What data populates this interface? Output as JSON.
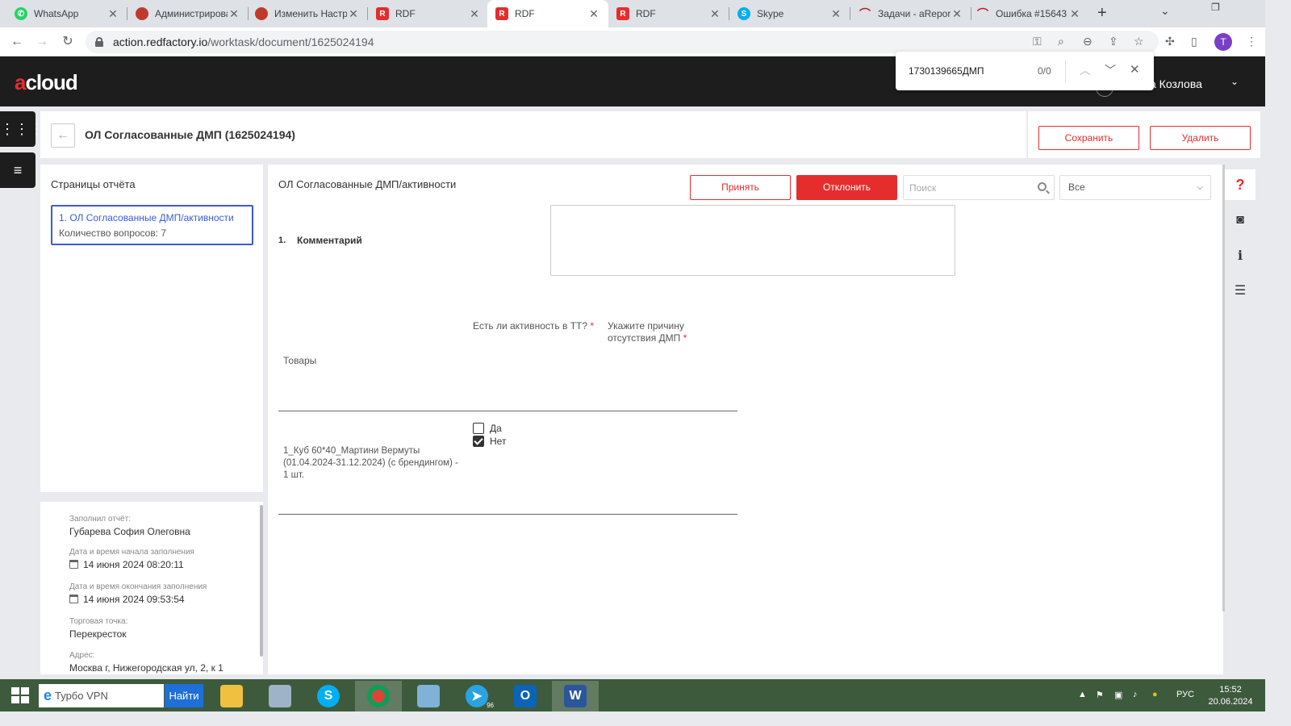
{
  "browser": {
    "tabs": [
      {
        "title": "WhatsApp",
        "icon": "whatsapp-icon",
        "color": "#25d366"
      },
      {
        "title": "Администрирование",
        "icon": "app-icon",
        "color": "#c0392b"
      },
      {
        "title": "Изменить Настройки",
        "icon": "app-icon",
        "color": "#c0392b"
      },
      {
        "title": "RDF",
        "icon": "rdf-icon",
        "color": "#e52d2d"
      },
      {
        "title": "RDF",
        "icon": "rdf-icon",
        "color": "#e52d2d",
        "active": true
      },
      {
        "title": "RDF",
        "icon": "rdf-icon",
        "color": "#e52d2d"
      },
      {
        "title": "Skype",
        "icon": "skype-icon",
        "color": "#00aff0"
      },
      {
        "title": "Задачи - aReport",
        "icon": "redmine-icon",
        "color": "#b32024"
      },
      {
        "title": "Ошибка #15643",
        "icon": "redmine-icon",
        "color": "#b32024"
      }
    ],
    "url_domain": "action.redfactory.io",
    "url_path": "/worktask/document/1625024194",
    "profile_initial": "T"
  },
  "find_bar": {
    "query": "1730139665ДМП",
    "count": "0/0"
  },
  "app": {
    "logo_accent": "a",
    "logo_rest": "cloud",
    "user_name": "а Козлова"
  },
  "document": {
    "title": "ОЛ Согласованные ДМП (1625024194)",
    "save_label": "Сохранить",
    "delete_label": "Удалить"
  },
  "pages_panel": {
    "heading": "Страницы отчёта",
    "items": [
      {
        "label": "1.   ОЛ Согласованные ДМП/активности",
        "sub": "Количество вопросов: 7"
      }
    ]
  },
  "info": {
    "filled_by_label": "Заполнил отчёт:",
    "filled_by": "Губарева София Олеговна",
    "start_label": "Дата и время начала заполнения",
    "start": "14 июня 2024 08:20:11",
    "end_label": "Дата и время окончания заполнения",
    "end": "14 июня 2024 09:53:54",
    "outlet_label": "Торговая точка:",
    "outlet": "Перекресток",
    "address_label": "Адрес:",
    "address": "Москва г, Нижегородская ул, 2, к 1"
  },
  "main": {
    "heading": "ОЛ Согласованные ДМП/активности",
    "accept_label": "Принять",
    "reject_label": "Отклонить",
    "search_placeholder": "Поиск",
    "filter_value": "Все",
    "question_num": "1.",
    "question_label": "Комментарий",
    "col_activity": "Есть ли активность в ТТ?",
    "col_reason_1": "Укажите причину",
    "col_reason_2": "отсутствия ДМП",
    "col_goods": "Товары",
    "product": "1_Куб 60*40_Мартини Вермуты (01.04.2024-31.12.2024) (с брендингом) - 1 шт.",
    "option_yes": "Да",
    "option_no": "Нет",
    "option_yes_checked": false,
    "option_no_checked": true
  },
  "taskbar": {
    "search_text": "Турбо VPN",
    "find_label": "Найти",
    "lang": "РУС",
    "time": "15:52",
    "date": "20.06.2024",
    "telegram_badge": "96"
  },
  "colors": {
    "accent": "#e52d2d",
    "link": "#3a5bd9",
    "header_bg": "#1d1d1d"
  }
}
